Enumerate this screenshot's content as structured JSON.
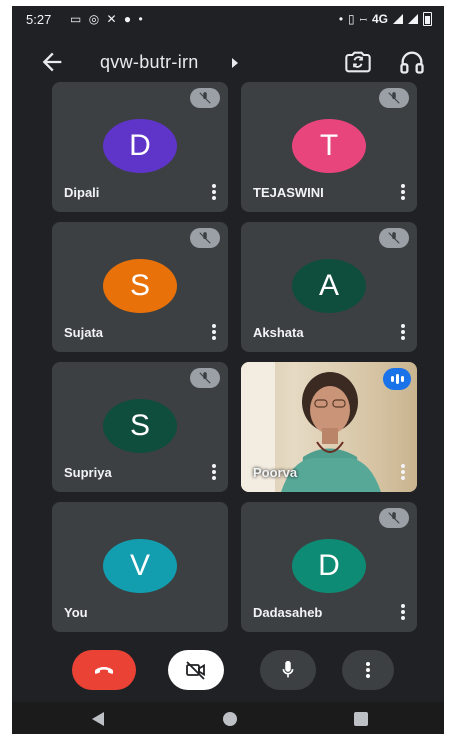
{
  "status_bar": {
    "time": "5:27",
    "left_icons": [
      "notification-icon",
      "whatsapp-icon",
      "missed-call-icon",
      "chat-icon",
      "dot-icon"
    ],
    "network": "4G",
    "right_icons": [
      "location-icon",
      "vibrate-icon",
      "volte-icon",
      "signal-icon",
      "signal-icon",
      "battery-icon"
    ]
  },
  "header": {
    "meeting_code": "qvw-butr-irn",
    "icons": [
      "back-arrow-icon",
      "expand-triangle-icon",
      "switch-camera-icon",
      "headphones-icon"
    ]
  },
  "participants": [
    {
      "initial": "D",
      "name": "Dipali",
      "color": "#5f35c9",
      "muted": true
    },
    {
      "initial": "T",
      "name": "TEJASWINI",
      "color": "#e8457c",
      "muted": true
    },
    {
      "initial": "S",
      "name": "Sujata",
      "color": "#e8710a",
      "muted": true
    },
    {
      "initial": "A",
      "name": "Akshata",
      "color": "#0f4d3c",
      "muted": true
    },
    {
      "initial": "S",
      "name": "Supriya",
      "color": "#0f4d3c",
      "muted": true
    },
    {
      "initial": "",
      "name": "Poorva",
      "video": true,
      "speaking": true
    },
    {
      "initial": "V",
      "name": "You",
      "color": "#129eaf",
      "muted": false
    },
    {
      "initial": "D",
      "name": "Dadasaheb",
      "color": "#0e8b74",
      "muted": true
    }
  ],
  "controls": {
    "end_call": {
      "icon": "end-call-icon",
      "color": "#ea4335"
    },
    "camera": {
      "icon": "camera-off-icon"
    },
    "microphone": {
      "icon": "microphone-icon"
    },
    "more": {
      "icon": "more-vertical-icon"
    }
  },
  "nav": [
    "nav-back-icon",
    "nav-home-icon",
    "nav-recent-icon"
  ]
}
